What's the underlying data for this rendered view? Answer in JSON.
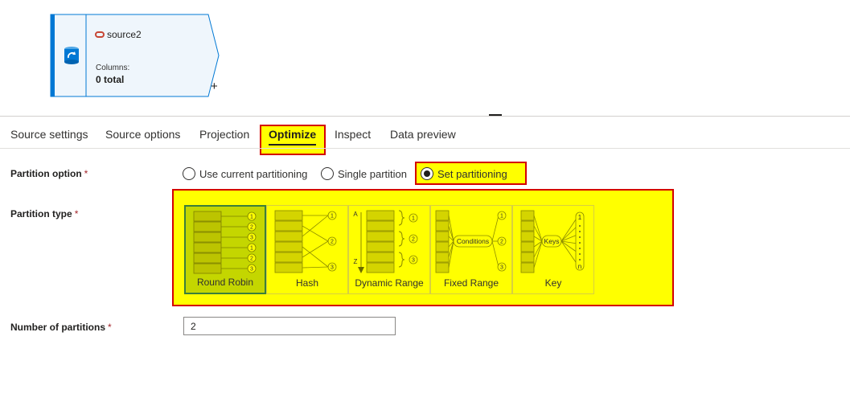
{
  "node": {
    "title": "source2",
    "columns_label": "Columns:",
    "columns_value": "0 total",
    "add_symbol": "+",
    "icon": "refresh-dataset-icon",
    "brand_icon": "oracle-icon",
    "accent_color": "#0078d4",
    "brand_color": "#c74634"
  },
  "tabs": [
    {
      "label": "Source settings",
      "active": false
    },
    {
      "label": "Source options",
      "active": false
    },
    {
      "label": "Projection",
      "active": false
    },
    {
      "label": "Optimize",
      "active": true
    },
    {
      "label": "Inspect",
      "active": false
    },
    {
      "label": "Data preview",
      "active": false
    }
  ],
  "partition_option": {
    "label": "Partition option",
    "required_mark": "*",
    "options": [
      {
        "label": "Use current partitioning",
        "selected": false
      },
      {
        "label": "Single partition",
        "selected": false
      },
      {
        "label": "Set partitioning",
        "selected": true
      }
    ]
  },
  "partition_type": {
    "label": "Partition type",
    "required_mark": "*",
    "options": [
      {
        "label": "Round Robin",
        "selected": true,
        "icon": "round-robin-icon"
      },
      {
        "label": "Hash",
        "selected": false,
        "icon": "hash-icon"
      },
      {
        "label": "Dynamic Range",
        "selected": false,
        "icon": "dynamic-range-icon"
      },
      {
        "label": "Fixed Range",
        "selected": false,
        "icon": "fixed-range-icon"
      },
      {
        "label": "Key",
        "selected": false,
        "icon": "key-icon"
      }
    ],
    "diagram_text": {
      "conditions": "Conditions",
      "keys": "Keys",
      "axis_start": "A",
      "axis_end": "Z",
      "n": "n",
      "one": "1",
      "two": "2",
      "three": "3"
    }
  },
  "num_partitions": {
    "label": "Number of partitions",
    "required_mark": "*",
    "value": "2"
  },
  "highlight": {
    "fill": "#ffff00",
    "border": "#d40000"
  }
}
